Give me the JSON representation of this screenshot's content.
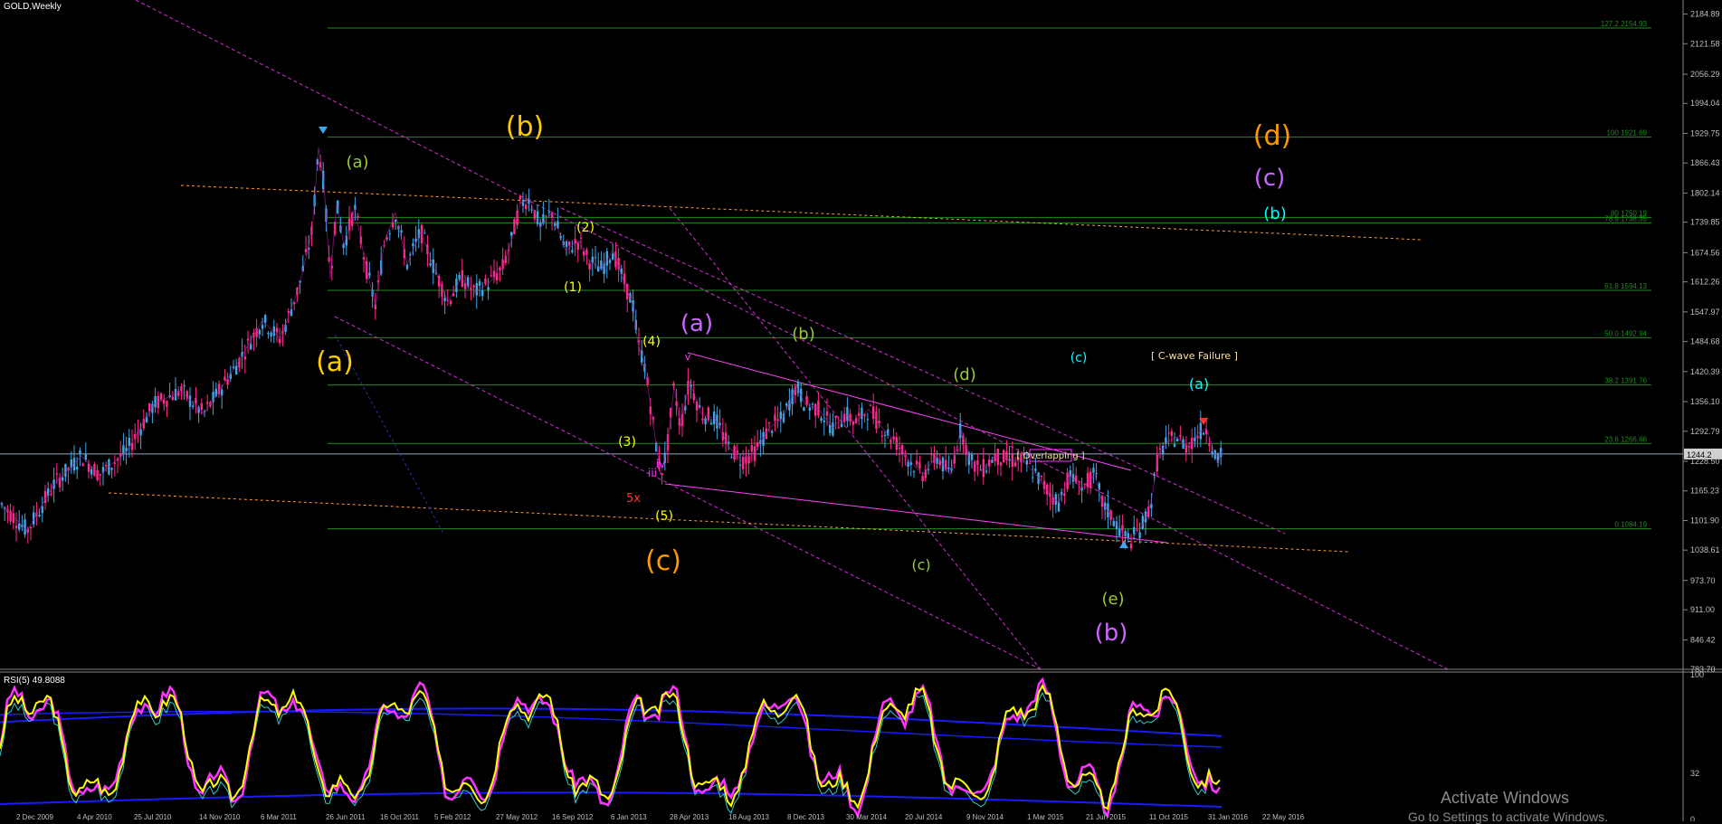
{
  "symbol": "GOLD,Weekly",
  "colors": {
    "background": "#000000",
    "bull": "#3fa6e8",
    "bear": "#ff2a8a",
    "fib": "#1f8a1f",
    "rsi_main": "#ffff00",
    "rsi_band": "#1a1aff",
    "channel": "#ff33ff",
    "axis_text": "#bfbfbf"
  },
  "chart_data": {
    "type": "line",
    "title": "GOLD,Weekly",
    "ylim": [
      783.7,
      2215
    ],
    "y_ticks": [
      "2184.89",
      "2121.58",
      "2056.29",
      "1994.04",
      "1929.75",
      "1866.43",
      "1802.14",
      "1739.85",
      "1674.56",
      "1612.26",
      "1547.97",
      "1484.68",
      "1420.39",
      "1356.10",
      "1292.79",
      "1228.50",
      "1165.23",
      "1101.90",
      "1038.61",
      "973.70",
      "911.00",
      "846.42",
      "783.70"
    ],
    "x_ticks": [
      "2 Dec 2009",
      "4 Apr 2010",
      "25 Jul 2010",
      "14 Nov 2010",
      "6 Mar 2011",
      "26 Jun 2011",
      "16 Oct 2011",
      "5 Feb 2012",
      "27 May 2012",
      "16 Sep 2012",
      "6 Jan 2013",
      "28 Apr 2013",
      "18 Aug 2013",
      "8 Dec 2013",
      "30 Mar 2014",
      "20 Jul 2014",
      "9 Nov 2014",
      "1 Mar 2015",
      "21 Jun 2015",
      "11 Oct 2015",
      "31 Jan 2016",
      "22 May 2016"
    ],
    "current_price": "1244.2",
    "fib_levels": [
      {
        "label": "127.2 2154.93",
        "value": 2154.93
      },
      {
        "label": "100 1921.69",
        "value": 1921.69
      },
      {
        "label": "80 1750.19",
        "value": 1750.19
      },
      {
        "label": "78.6 1738.35",
        "value": 1738.35
      },
      {
        "label": "61.8 1594.13",
        "value": 1594.13
      },
      {
        "label": "50.0 1492.94",
        "value": 1492.94
      },
      {
        "label": "38.2 1391.76",
        "value": 1391.76
      },
      {
        "label": "23.6 1266.66",
        "value": 1266.66
      },
      {
        "label": "0.1084.19",
        "value": 1084.19
      }
    ],
    "price_waypoints": [
      [
        0,
        1140
      ],
      [
        30,
        1080
      ],
      [
        60,
        1180
      ],
      [
        90,
        1240
      ],
      [
        110,
        1200
      ],
      [
        140,
        1250
      ],
      [
        170,
        1350
      ],
      [
        200,
        1380
      ],
      [
        225,
        1330
      ],
      [
        260,
        1430
      ],
      [
        290,
        1530
      ],
      [
        310,
        1490
      ],
      [
        330,
        1600
      ],
      [
        345,
        1720
      ],
      [
        352,
        1900
      ],
      [
        358,
        1820
      ],
      [
        365,
        1620
      ],
      [
        372,
        1780
      ],
      [
        380,
        1690
      ],
      [
        392,
        1770
      ],
      [
        405,
        1640
      ],
      [
        415,
        1560
      ],
      [
        425,
        1700
      ],
      [
        437,
        1760
      ],
      [
        450,
        1650
      ],
      [
        465,
        1720
      ],
      [
        480,
        1640
      ],
      [
        495,
        1570
      ],
      [
        510,
        1620
      ],
      [
        525,
        1590
      ],
      [
        540,
        1610
      ],
      [
        555,
        1640
      ],
      [
        565,
        1700
      ],
      [
        575,
        1780
      ],
      [
        585,
        1790
      ],
      [
        597,
        1730
      ],
      [
        610,
        1760
      ],
      [
        625,
        1680
      ],
      [
        640,
        1700
      ],
      [
        650,
        1660
      ],
      [
        665,
        1640
      ],
      [
        677,
        1680
      ],
      [
        690,
        1610
      ],
      [
        700,
        1560
      ],
      [
        705,
        1480
      ],
      [
        712,
        1440
      ],
      [
        718,
        1360
      ],
      [
        730,
        1200
      ],
      [
        737,
        1250
      ],
      [
        745,
        1390
      ],
      [
        752,
        1300
      ],
      [
        762,
        1400
      ],
      [
        775,
        1330
      ],
      [
        790,
        1320
      ],
      [
        805,
        1260
      ],
      [
        820,
        1230
      ],
      [
        835,
        1250
      ],
      [
        850,
        1300
      ],
      [
        865,
        1320
      ],
      [
        880,
        1390
      ],
      [
        890,
        1350
      ],
      [
        905,
        1340
      ],
      [
        920,
        1300
      ],
      [
        935,
        1330
      ],
      [
        945,
        1310
      ],
      [
        960,
        1340
      ],
      [
        975,
        1300
      ],
      [
        990,
        1270
      ],
      [
        1005,
        1230
      ],
      [
        1020,
        1200
      ],
      [
        1035,
        1240
      ],
      [
        1050,
        1200
      ],
      [
        1062,
        1300
      ],
      [
        1072,
        1230
      ],
      [
        1085,
        1210
      ],
      [
        1100,
        1240
      ],
      [
        1115,
        1230
      ],
      [
        1130,
        1230
      ],
      [
        1145,
        1200
      ],
      [
        1160,
        1160
      ],
      [
        1170,
        1140
      ],
      [
        1182,
        1200
      ],
      [
        1195,
        1170
      ],
      [
        1210,
        1200
      ],
      [
        1218,
        1140
      ],
      [
        1232,
        1100
      ],
      [
        1242,
        1070
      ],
      [
        1250,
        1060
      ],
      [
        1262,
        1090
      ],
      [
        1272,
        1140
      ],
      [
        1280,
        1240
      ],
      [
        1290,
        1270
      ],
      [
        1300,
        1280
      ],
      [
        1312,
        1260
      ],
      [
        1325,
        1290
      ],
      [
        1333,
        1300
      ],
      [
        1340,
        1260
      ],
      [
        1346,
        1225
      ],
      [
        1350,
        1250
      ]
    ],
    "wave_labels": [
      {
        "text": "(a)",
        "color": "#ffcc00"
      },
      {
        "text": "(b)",
        "color": "#ffcc00"
      },
      {
        "text": "(c)",
        "color": "#ff9900"
      },
      {
        "text": "(d)",
        "color": "#ff9900"
      },
      {
        "text": "(c)",
        "color": "#cc66ff"
      },
      {
        "text": "(a)",
        "color": "#cc66ff"
      },
      {
        "text": "(b)",
        "color": "#cc66ff"
      },
      {
        "text": "(a)",
        "color": "#99cc33"
      },
      {
        "text": "(c)",
        "color": "#99cc33"
      },
      {
        "text": "(e)",
        "color": "#99cc33"
      },
      {
        "text": "(b)",
        "color": "#99cc33"
      },
      {
        "text": "(d)",
        "color": "#99cc33"
      },
      {
        "text": "(b)",
        "color": "#00ffff"
      },
      {
        "text": "(a)",
        "color": "#00ffff"
      },
      {
        "text": "(c)",
        "color": "#00ffff"
      },
      {
        "text": "(1)",
        "color": "#ffff00"
      },
      {
        "text": "(2)",
        "color": "#ffff00"
      },
      {
        "text": "(3)",
        "color": "#ffff00"
      },
      {
        "text": "(4)",
        "color": "#ffff00"
      },
      {
        "text": "(5)",
        "color": "#ffff00"
      },
      {
        "text": "5x",
        "color": "#ff3333"
      },
      {
        "text": "iii",
        "color": "#ff33ff"
      },
      {
        "text": "iv",
        "color": "#ff33ff"
      },
      {
        "text": "v",
        "color": "#ff33ff"
      },
      {
        "text": "[ C-wave Failure ]",
        "color": "#ffe0a0"
      },
      {
        "text": "[ Overlapping ]",
        "color": "#ffe0a0"
      },
      {
        "text": "1232.68",
        "color": "#ff33ff"
      }
    ]
  },
  "rsi": {
    "label": "RSI(5) 49.8088",
    "levels": [
      "100",
      "32",
      "0"
    ]
  },
  "watermark": {
    "line1": "Activate Windows",
    "line2": "Go to Settings to activate Windows."
  }
}
